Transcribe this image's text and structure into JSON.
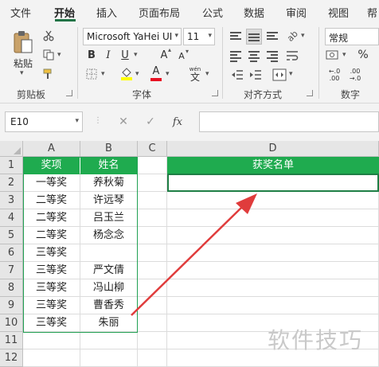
{
  "menu": {
    "tabs": [
      "文件",
      "开始",
      "插入",
      "页面布局",
      "公式",
      "数据",
      "审阅",
      "视图",
      "帮"
    ],
    "active_tab": "开始"
  },
  "ribbon": {
    "clipboard": {
      "paste_label": "粘贴",
      "group_label": "剪贴板"
    },
    "font": {
      "font_name": "Microsoft YaHei UI",
      "font_size": "11",
      "bold": "B",
      "italic": "I",
      "underline": "U",
      "grow_font": "A",
      "shrink_font": "A",
      "font_color_letter": "A",
      "phonetic": "wén",
      "phonetic_char": "文",
      "group_label": "字体"
    },
    "alignment": {
      "group_label": "对齐方式"
    },
    "number": {
      "format": "常规",
      "group_label": "数字"
    },
    "colors": {
      "accent": "#217346",
      "fill_color": "#ffff00",
      "font_color": "#e81123"
    }
  },
  "formula_bar": {
    "name_box": "E10",
    "cancel": "✕",
    "enter": "✓",
    "fx": "fx",
    "formula": ""
  },
  "sheet": {
    "columns": [
      "A",
      "B",
      "C",
      "D"
    ],
    "rows": [
      "1",
      "2",
      "3",
      "4",
      "5",
      "6",
      "7",
      "8",
      "9",
      "10",
      "11",
      "12"
    ],
    "header_row": {
      "A": "奖项",
      "B": "姓名",
      "D": "获奖名单"
    },
    "data": [
      {
        "prize": "一等奖",
        "name": "养秋菊"
      },
      {
        "prize": "二等奖",
        "name": "许远琴"
      },
      {
        "prize": "二等奖",
        "name": "吕玉兰"
      },
      {
        "prize": "二等奖",
        "name": "杨念念"
      },
      {
        "prize": "三等奖",
        "name": ""
      },
      {
        "prize": "三等奖",
        "name": "严文倩"
      },
      {
        "prize": "三等奖",
        "name": "冯山柳"
      },
      {
        "prize": "三等奖",
        "name": "曹香秀"
      },
      {
        "prize": "三等奖",
        "name": "朱丽"
      }
    ],
    "header_color": "#1fab4f",
    "annotation_color": "#e03c3c"
  },
  "watermark": "软件技巧"
}
